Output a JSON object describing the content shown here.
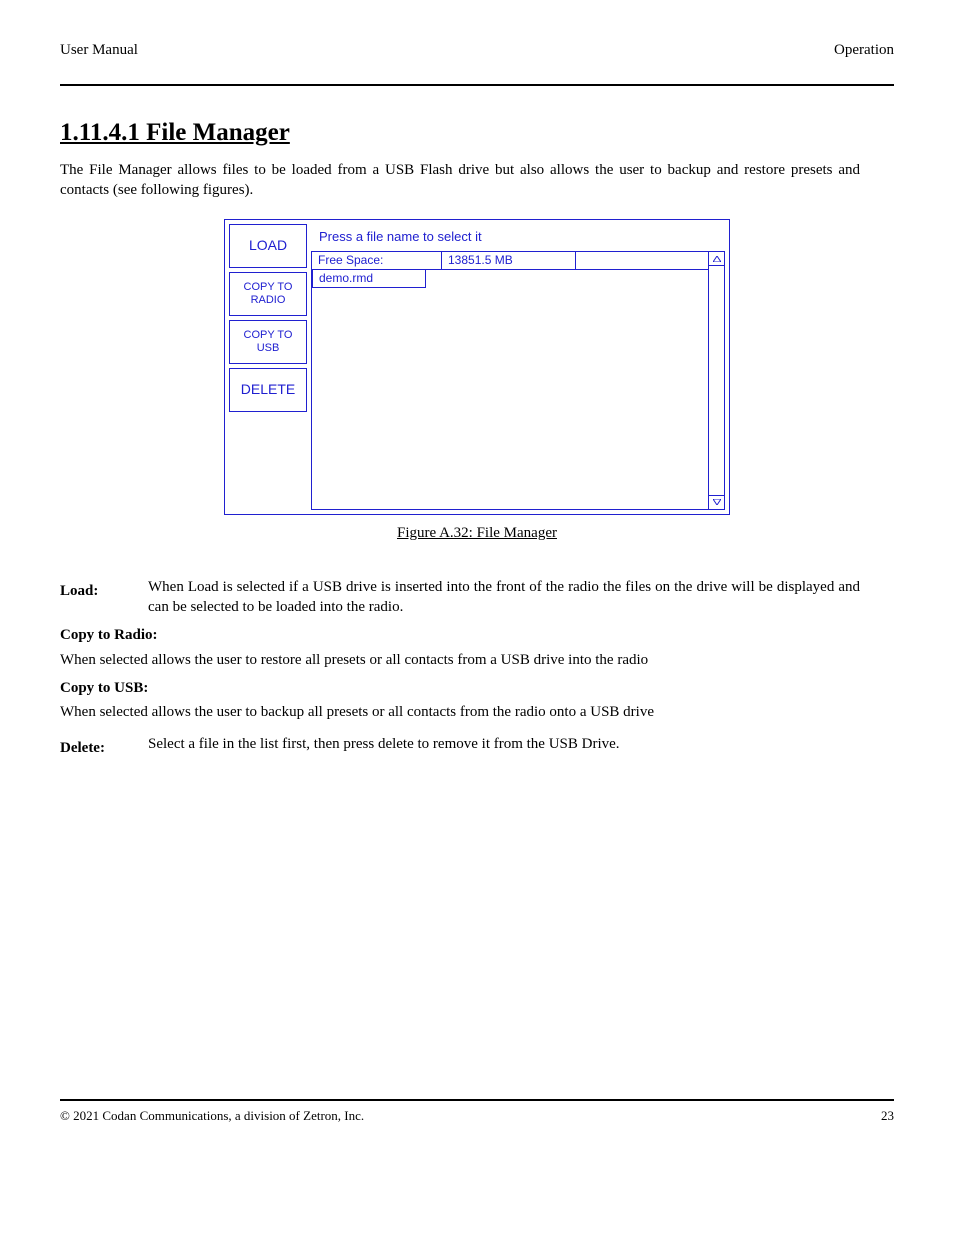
{
  "header": {
    "left": "User Manual",
    "right": "Operation"
  },
  "section_title": "1.11.4.1  File Manager",
  "intro": "The File Manager allows files to be loaded from a USB Flash drive but also allows the user to backup and restore presets and contacts (see following figures).",
  "fm": {
    "instruction": "Press a file name to select it",
    "columns": [
      "Free Space:",
      "13851.5 MB",
      ""
    ],
    "row_file": "demo.rmd",
    "sidebar": [
      "LOAD",
      "COPY TO RADIO",
      "COPY TO USB",
      "DELETE"
    ]
  },
  "figcap": "Figure A.32: File Manager",
  "defs": {
    "load": {
      "term": "Load:",
      "desc": "When Load is selected if a USB drive is inserted into the front of the radio the files on the drive will be displayed and can be selected to be loaded into the radio."
    },
    "copy_to_radio": {
      "term": "Copy to Radio:",
      "desc": "When selected allows the user to restore all presets or all contacts from a USB drive into the radio"
    },
    "copy_to_usb": {
      "term": "Copy to USB:",
      "desc": "When selected allows the user to backup all presets or all contacts from the radio onto a USB drive"
    },
    "delete": {
      "term": "Delete:",
      "desc": "Select a file in the list first, then press delete to remove it from the USB Drive."
    }
  },
  "footer": {
    "left": "© 2021 Codan Communications, a division of Zetron, Inc.",
    "right": "23"
  }
}
